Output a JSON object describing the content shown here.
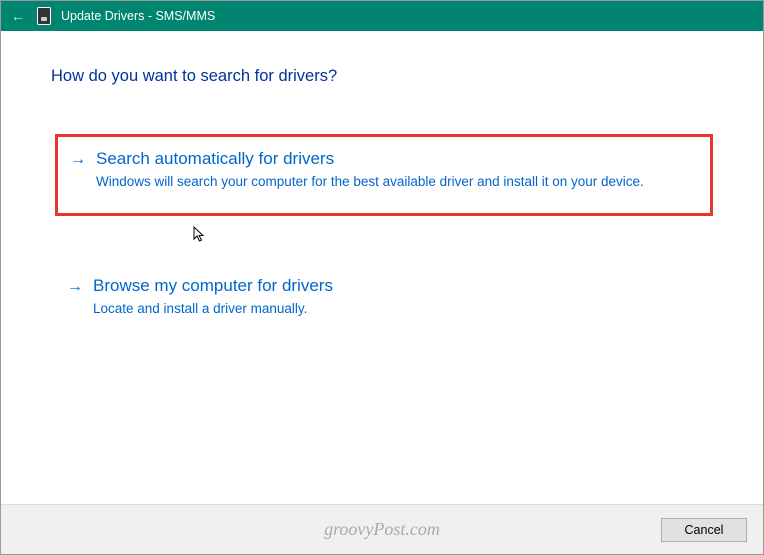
{
  "titlebar": {
    "text": "Update Drivers - SMS/MMS"
  },
  "page": {
    "title": "How do you want to search for drivers?"
  },
  "options": [
    {
      "title": "Search automatically for drivers",
      "desc": "Windows will search your computer for the best available driver and install it on your device.",
      "highlighted": true
    },
    {
      "title": "Browse my computer for drivers",
      "desc": "Locate and install a driver manually.",
      "highlighted": false
    }
  ],
  "footer": {
    "cancel": "Cancel"
  },
  "watermark": "groovyPost.com"
}
